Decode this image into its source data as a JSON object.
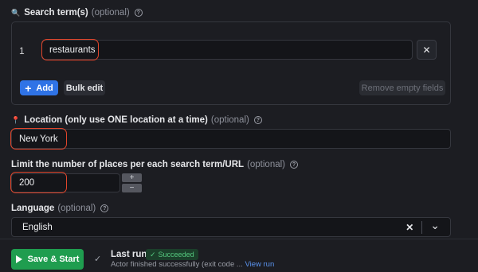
{
  "search": {
    "emoji": "🔍",
    "label": "Search term(s)",
    "optional": "(optional)",
    "rows": [
      {
        "index": "1",
        "value": "restaurants"
      }
    ],
    "remove_row_symbol": "✕",
    "add_label": "Add",
    "add_symbol": "+",
    "bulk_edit_label": "Bulk edit",
    "remove_empty_label": "Remove empty fields"
  },
  "location": {
    "emoji": "📍",
    "label": "Location (only use ONE location at a time)",
    "optional": "(optional)",
    "value": "New York"
  },
  "limit": {
    "label": "Limit the number of places per each search term/URL",
    "optional": "(optional)",
    "value": "200",
    "increment_symbol": "+",
    "decrement_symbol": "−"
  },
  "language": {
    "label": "Language",
    "optional": "(optional)",
    "value": "English",
    "clear_symbol": "✕",
    "dropdown_symbol": "⌄"
  },
  "help_symbol": "?",
  "footer": {
    "start_label": "Save & Start",
    "check_symbol": "✓",
    "last_run_label": "Last run",
    "status_badge": "Succeeded",
    "status_text": "Actor finished successfully (exit code ...",
    "view_run_link": "View run"
  },
  "colors": {
    "background": "#1c1d22",
    "accent_blue": "#2f73e6",
    "start_green": "#1f9d4f",
    "highlight_red": "#e0452b",
    "success_green": "#55c97f"
  }
}
